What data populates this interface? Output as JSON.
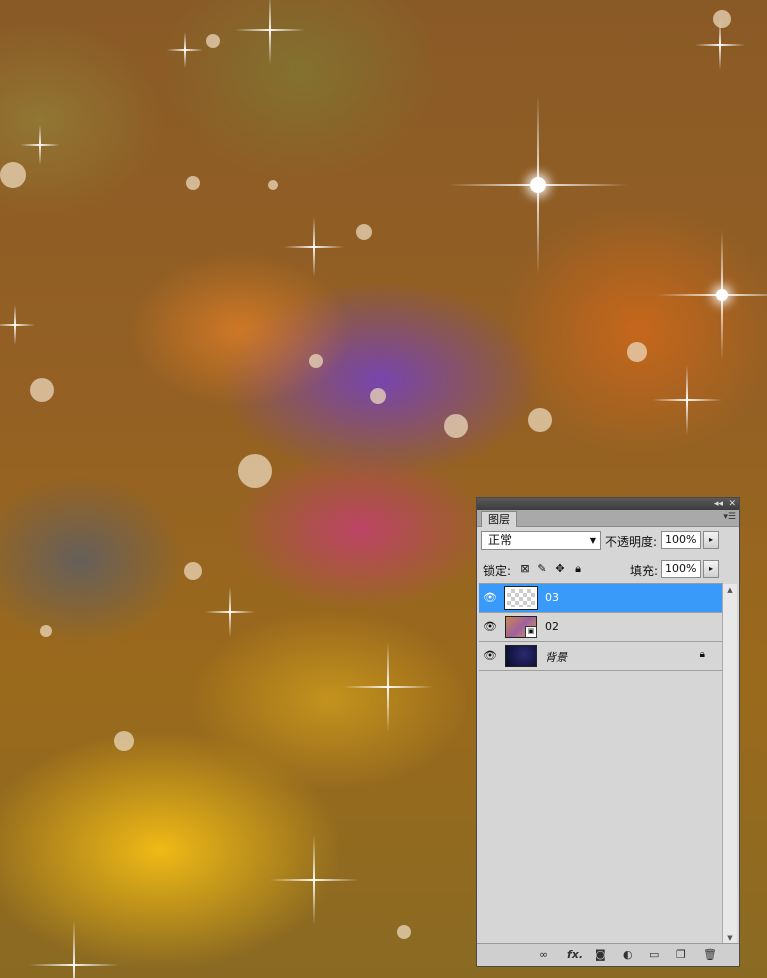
{
  "panel": {
    "title_controls": {
      "collapse": "◂◂",
      "close": "✕"
    },
    "tab_label": "图层",
    "menu_icon": "panel-menu-icon",
    "blend_mode": "正常",
    "opacity_label": "不透明度:",
    "opacity_value": "100%",
    "lock_label": "锁定:",
    "fill_label": "填充:",
    "fill_value": "100%",
    "lock_icons": [
      "lock-transparent-pixels-icon",
      "lock-image-pixels-icon",
      "lock-position-icon",
      "lock-all-icon"
    ],
    "layers": [
      {
        "name": "03",
        "selected": true,
        "thumb": "transparent"
      },
      {
        "name": "02",
        "selected": false,
        "thumb": "smart-object"
      },
      {
        "name": "背景",
        "selected": false,
        "thumb": "background",
        "locked": true
      }
    ],
    "bottom_icons": [
      "link-layers-icon",
      "fx-icon",
      "add-mask-icon",
      "adjustment-layer-icon",
      "new-group-icon",
      "new-layer-icon",
      "delete-layer-icon"
    ]
  }
}
